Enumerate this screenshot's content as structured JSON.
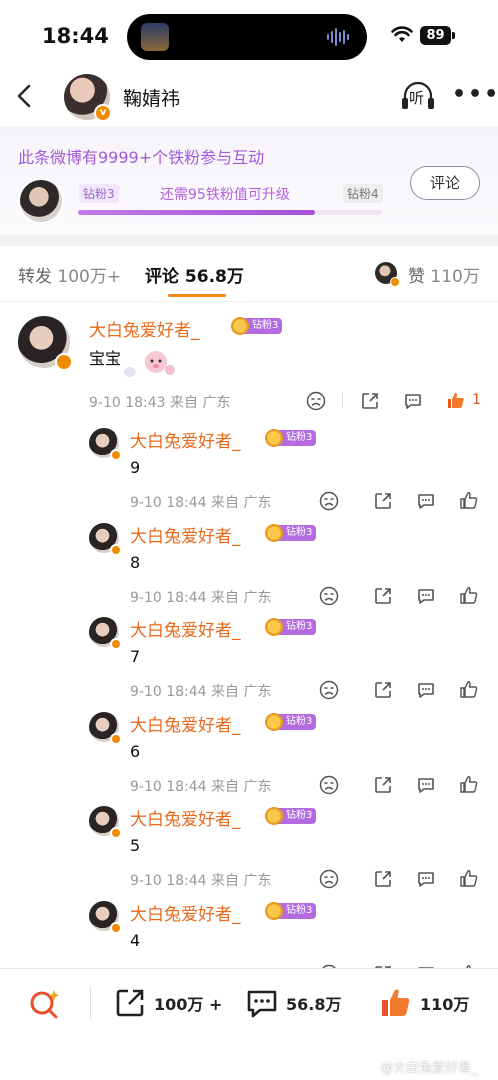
{
  "status_bar": {
    "time": "18:44",
    "battery": "89"
  },
  "nav": {
    "username": "鞠婧祎",
    "listen_label": "听"
  },
  "fan_banner": {
    "title": "此条微博有9999+个铁粉参与互动",
    "current_level": "钻粉3",
    "next_level": "钻粉4",
    "upgrade_text": "还需95铁粉值可升级",
    "progress": 0.78,
    "button_label": "评论"
  },
  "tabs": {
    "repost": {
      "label": "转发",
      "count": "100万+"
    },
    "comment": {
      "label": "评论",
      "count": "56.8万"
    },
    "like": {
      "label": "赞",
      "count": "110万"
    }
  },
  "main_comment": {
    "username": "大白兔爱好者_",
    "badge": "钻粉3",
    "text": "宝宝",
    "date": "9-10 18:43",
    "location": "来自 广东",
    "like_count": "1"
  },
  "replies": [
    {
      "username": "大白兔爱好者_",
      "badge": "钻粉3",
      "text": "9",
      "date": "9-10 18:44",
      "location": "来自 广东"
    },
    {
      "username": "大白兔爱好者_",
      "badge": "钻粉3",
      "text": "8",
      "date": "9-10 18:44",
      "location": "来自 广东"
    },
    {
      "username": "大白兔爱好者_",
      "badge": "钻粉3",
      "text": "7",
      "date": "9-10 18:44",
      "location": "来自 广东"
    },
    {
      "username": "大白兔爱好者_",
      "badge": "钻粉3",
      "text": "6",
      "date": "9-10 18:44",
      "location": "来自 广东"
    },
    {
      "username": "大白兔爱好者_",
      "badge": "钻粉3",
      "text": "5",
      "date": "9-10 18:44",
      "location": "来自 广东"
    },
    {
      "username": "大白兔爱好者_",
      "badge": "钻粉3",
      "text": "4",
      "date": "",
      "location": ""
    }
  ],
  "bottom_bar": {
    "repost_count": "100万 +",
    "comment_count": "56.8万",
    "like_count": "110万"
  },
  "watermark": "@大白兔爱好者_",
  "colors": {
    "accent": "#f28a16",
    "username": "#ea6a1c",
    "purple": "#a35ad9"
  }
}
